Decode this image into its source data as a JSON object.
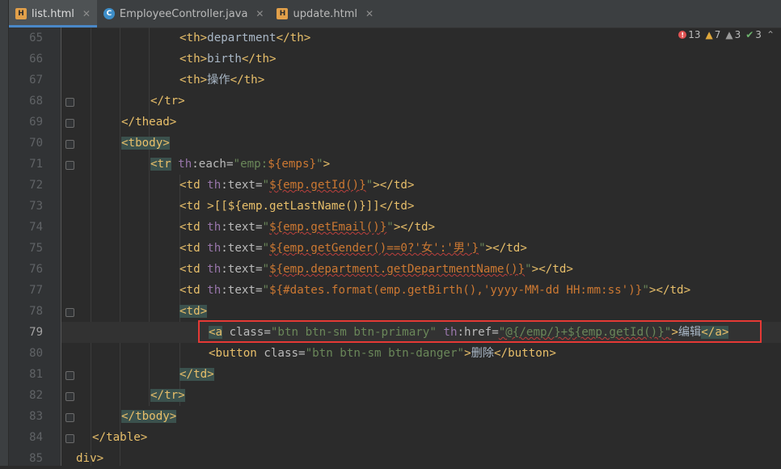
{
  "tabs": [
    {
      "label": "list.html",
      "icon": "html-file-icon",
      "active": true
    },
    {
      "label": "EmployeeController.java",
      "icon": "java-class-icon",
      "active": false
    },
    {
      "label": "update.html",
      "icon": "html-file-icon",
      "active": false
    }
  ],
  "inspections": {
    "errors": "13",
    "warnings": "7",
    "weak_warnings": "3",
    "typos": "3"
  },
  "line_numbers": [
    "65",
    "66",
    "67",
    "68",
    "69",
    "70",
    "71",
    "72",
    "73",
    "74",
    "75",
    "76",
    "77",
    "78",
    "79",
    "80",
    "81",
    "82",
    "83",
    "84",
    "85"
  ],
  "current_line": "79",
  "colors": {
    "tag": "#e8bf6a",
    "string": "#6a8759",
    "namespace": "#9876aa",
    "highlight_box": "#e53935"
  },
  "code": {
    "l65": {
      "open": "<th>",
      "text": "department",
      "close": "</th>"
    },
    "l66": {
      "open": "<th>",
      "text": "birth",
      "close": "</th>"
    },
    "l67": {
      "open": "<th>",
      "text": "操作",
      "close": "</th>"
    },
    "l68": {
      "close": "</tr>"
    },
    "l69": {
      "close": "</thead>"
    },
    "l70": {
      "open": "<tbody>"
    },
    "l71": {
      "open": "<tr",
      "ns": "th",
      "attr": ":each=",
      "q1": "\"",
      "val": "emp:",
      "expr": "${emps}",
      "q2": "\"",
      "end": ">"
    },
    "l72": {
      "open": "<td",
      "ns": "th",
      "attr": ":text=",
      "q1": "\"",
      "expr": "${emp.getId()}",
      "q2": "\"",
      "end": "></td>"
    },
    "l73": {
      "open": "<td",
      "rest": " >[[${emp.getLastName()}]]</td>"
    },
    "l74": {
      "open": "<td",
      "ns": "th",
      "attr": ":text=",
      "q1": "\"",
      "expr": "${emp.getEmail()}",
      "q2": "\"",
      "end": "></td>"
    },
    "l75": {
      "open": "<td",
      "ns": "th",
      "attr": ":text=",
      "q1": "\"",
      "expr": "${emp.getGender()==0?'女':'男'}",
      "q2": "\"",
      "end": "></td>"
    },
    "l76": {
      "open": "<td",
      "ns": "th",
      "attr": ":text=",
      "q1": "\"",
      "expr": "${emp.department.getDepartmentName()}",
      "q2": "\"",
      "end": "></td>"
    },
    "l77": {
      "open": "<td",
      "ns": "th",
      "attr": ":text=",
      "q1": "\"",
      "expr": "${#dates.format(emp.getBirth(),'yyyy-MM-dd HH:mm:ss')}",
      "q2": "\"",
      "end": "></td>"
    },
    "l78": {
      "open": "<td>"
    },
    "l79": {
      "open": "<a",
      "a1": " class=",
      "s1": "\"btn btn-sm btn-primary\"",
      "ns": " th",
      "a2": ":href=",
      "s2": "\"@{/emp/}+${emp.getId()}\"",
      "gt": ">",
      "text": "编辑",
      "close": "</a>"
    },
    "l80": {
      "open": "<button",
      "a1": " class=",
      "s1": "\"btn btn-sm btn-danger\"",
      "gt": ">",
      "text": "删除",
      "close": "</button>"
    },
    "l81": {
      "close": "</td>"
    },
    "l82": {
      "close": "</tr>"
    },
    "l83": {
      "close": "</tbody>"
    },
    "l84": {
      "close": "</table>"
    },
    "l85": {
      "close": "div>"
    }
  }
}
